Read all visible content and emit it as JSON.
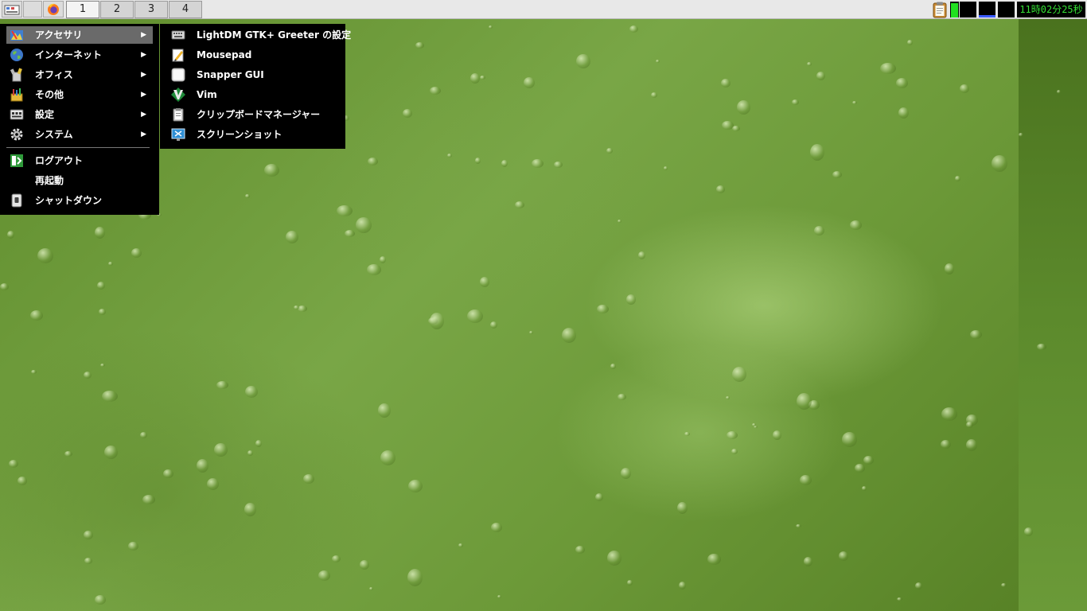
{
  "panel": {
    "workspaces": [
      "1",
      "2",
      "3",
      "4"
    ],
    "active_workspace": "1",
    "clock": "11時02分25秒",
    "icons": [
      "app-menu-icon",
      "blank-launcher-icon",
      "firefox-icon"
    ],
    "tray_icons": [
      "clipboard-icon",
      "cpu-monitor",
      "network-monitor",
      "memory-monitor",
      "disk-monitor"
    ]
  },
  "main_menu": {
    "items": [
      {
        "label": "アクセサリ",
        "icon": "accessories-icon",
        "submenu": true,
        "selected": true
      },
      {
        "label": "インターネット",
        "icon": "globe-icon",
        "submenu": true
      },
      {
        "label": "オフィス",
        "icon": "office-icon",
        "submenu": true
      },
      {
        "label": "その他",
        "icon": "other-icon",
        "submenu": true
      },
      {
        "label": "設定",
        "icon": "settings-icon",
        "submenu": true
      },
      {
        "label": "システム",
        "icon": "gear-icon",
        "submenu": true
      }
    ],
    "actions": [
      {
        "label": "ログアウト",
        "icon": "logout-icon"
      },
      {
        "label": "再起動",
        "icon": ""
      },
      {
        "label": "シャットダウン",
        "icon": "shutdown-icon"
      }
    ],
    "arrow": "▶"
  },
  "sub_menu": {
    "items": [
      {
        "label": "LightDM GTK+ Greeter の設定",
        "icon": "keyboard-icon"
      },
      {
        "label": "Mousepad",
        "icon": "text-editor-icon"
      },
      {
        "label": "Snapper GUI",
        "icon": "snapper-icon"
      },
      {
        "label": "Vim",
        "icon": "vim-icon"
      },
      {
        "label": "クリップボードマネージャー",
        "icon": "clipboard-icon"
      },
      {
        "label": "スクリーンショット",
        "icon": "screenshot-icon"
      }
    ]
  },
  "colors": {
    "menu_bg": "#000000",
    "menu_selected": "#6a6a6a",
    "clock_text": "#35e035",
    "panel_bg": "#e8e8e8"
  }
}
